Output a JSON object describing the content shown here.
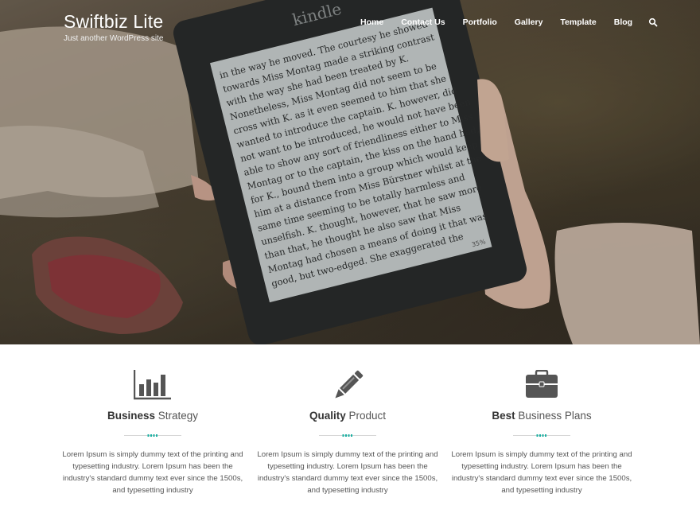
{
  "site": {
    "title": "Swiftbiz Lite",
    "tagline": "Just another WordPress site"
  },
  "nav": {
    "items": [
      {
        "label": "Home",
        "name": "nav-home"
      },
      {
        "label": "Contact Us",
        "name": "nav-contact-us"
      },
      {
        "label": "Portfolio",
        "name": "nav-portfolio"
      },
      {
        "label": "Gallery",
        "name": "nav-gallery"
      },
      {
        "label": "Template",
        "name": "nav-template"
      },
      {
        "label": "Blog",
        "name": "nav-blog"
      }
    ],
    "search_icon": "search-icon"
  },
  "hero": {
    "device_brand": "kindle",
    "page_indicator": "35%"
  },
  "colors": {
    "accent": "#1bb1a3",
    "icon": "#555555",
    "text": "#555555"
  },
  "features": [
    {
      "icon": "bar-chart-icon",
      "title_bold": "Business",
      "title_rest": " Strategy",
      "text": "Lorem Ipsum is simply dummy text of the printing and typesetting industry. Lorem Ipsum has been the industry's standard dummy text ever since the 1500s, and typesetting industry"
    },
    {
      "icon": "pencil-icon",
      "title_bold": "Quality",
      "title_rest": " Product",
      "text": "Lorem Ipsum is simply dummy text of the printing and typesetting industry. Lorem Ipsum has been the industry's standard dummy text ever since the 1500s, and typesetting industry"
    },
    {
      "icon": "briefcase-icon",
      "title_bold": "Best",
      "title_rest": " Business Plans",
      "text": "Lorem Ipsum is simply dummy text of the printing and typesetting industry. Lorem Ipsum has been the industry's standard dummy text ever since the 1500s, and typesetting industry"
    }
  ]
}
